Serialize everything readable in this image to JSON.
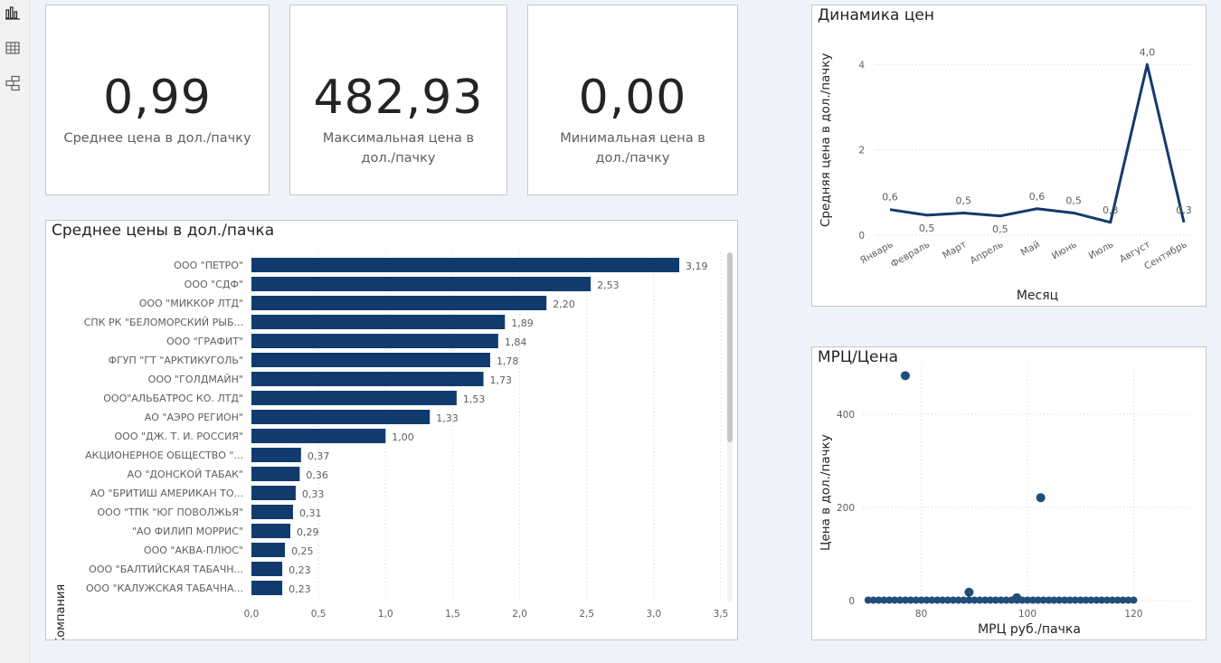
{
  "sidebar": {
    "items": [
      {
        "icon": "bar-chart-icon"
      },
      {
        "icon": "table-icon"
      },
      {
        "icon": "model-icon"
      }
    ]
  },
  "kpis": [
    {
      "value": "0,99",
      "label": "Среднее цена в дол./пачку"
    },
    {
      "value": "482,93",
      "label": "Максимальная цена в дол./пачку"
    },
    {
      "value": "0,00",
      "label": "Минимальная цена в дол./пачку"
    }
  ],
  "colors": {
    "bar": "#123b6d",
    "line": "#123b6d",
    "scatter": "#1f4e79",
    "background": "#eef3fb"
  },
  "chart_data": [
    {
      "type": "bar",
      "orientation": "horizontal",
      "title": "Среднее цены в дол./пачка",
      "ylabel": "Компания",
      "xlabel": "",
      "xlim": [
        0,
        3.5
      ],
      "x_ticks": [
        "0,0",
        "0,5",
        "1,0",
        "1,5",
        "2,0",
        "2,5",
        "3,0",
        "3,5"
      ],
      "grid": true,
      "categories": [
        "ООО \"ПЕТРО\"",
        "ООО \"СДФ\"",
        "ООО \"МИККОР ЛТД\"",
        "СПК РК \"БЕЛОМОРСКИЙ РЫБ...",
        "ООО \"ГРАФИТ\"",
        "ФГУП \"ГТ \"АРКТИКУГОЛЬ\"",
        "ООО \"ГОЛДМАЙН\"",
        "ООО\"АЛЬБАТРОС КО. ЛТД\"",
        "АО \"АЭРО РЕГИОН\"",
        "ООО \"ДЖ. Т. И. РОССИЯ\"",
        "АКЦИОНЕРНОЕ ОБЩЕСТВО \"...",
        "АО \"ДОНСКОЙ ТАБАК\"",
        "АО \"БРИТИШ АМЕРИКАН ТО...",
        "ООО \"ТПК \"ЮГ ПОВОЛЖЬЯ\"",
        "\"АО ФИЛИП МОРРИС\"",
        "ООО \"АКВА-ПЛЮС\"",
        "ООО \"БАЛТИЙСКАЯ ТАБАЧН...",
        "ООО \"КАЛУЖСКАЯ ТАБАЧНА..."
      ],
      "values": [
        3.19,
        2.53,
        2.2,
        1.89,
        1.84,
        1.78,
        1.73,
        1.53,
        1.33,
        1.0,
        0.37,
        0.36,
        0.33,
        0.31,
        0.29,
        0.25,
        0.23,
        0.23
      ],
      "value_labels": [
        "3,19",
        "2,53",
        "2,20",
        "1,89",
        "1,84",
        "1,78",
        "1,73",
        "1,53",
        "1,33",
        "1,00",
        "0,37",
        "0,36",
        "0,33",
        "0,31",
        "0,29",
        "0,25",
        "0,23",
        "0,23"
      ]
    },
    {
      "type": "line",
      "title": "Динамика цен",
      "xlabel": "Месяц",
      "ylabel": "Средняя цена в дол./пачку",
      "ylim": [
        0,
        4.6
      ],
      "y_ticks": [
        0,
        2,
        4
      ],
      "grid": true,
      "categories": [
        "Январь",
        "Февраль",
        "Март",
        "Апрель",
        "Май",
        "Июнь",
        "Июль",
        "Август",
        "Сентябрь"
      ],
      "values": [
        0.6,
        0.47,
        0.52,
        0.45,
        0.62,
        0.52,
        0.3,
        4.0,
        0.3
      ],
      "value_labels": [
        "0,6",
        "0,5",
        "0,5",
        "0,5",
        "0,6",
        "0,5",
        "0,3",
        "4,0",
        "0,3"
      ]
    },
    {
      "type": "scatter",
      "title": "МРЦ/Цена",
      "xlabel": "МРЦ руб./пачка",
      "ylabel": "Цена в дол./пачку",
      "xlim": [
        69,
        131
      ],
      "ylim": [
        0,
        505
      ],
      "x_ticks": [
        80,
        100,
        120
      ],
      "y_ticks": [
        0,
        200,
        400
      ],
      "grid": true,
      "points": [
        {
          "x": 77,
          "y": 483
        },
        {
          "x": 102.5,
          "y": 221
        },
        {
          "x": 89,
          "y": 18
        },
        {
          "x": 98,
          "y": 6
        }
      ],
      "baseline_cluster": {
        "x_range": [
          70,
          120
        ],
        "y": 1
      }
    }
  ]
}
